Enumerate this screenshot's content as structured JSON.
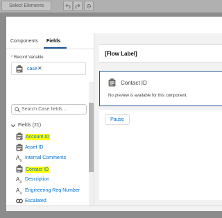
{
  "toolbar": {
    "select_elements_label": "Select Elements",
    "undo_icon": "undo-icon",
    "redo_icon": "redo-icon",
    "settings_icon": "gear-icon"
  },
  "palette": {
    "tabs": [
      {
        "label": "Components",
        "active": false
      },
      {
        "label": "Fields",
        "active": true
      }
    ],
    "record_variable": {
      "required_marker": "*",
      "label": "Record Variable",
      "value": "case",
      "remove_symbol": "✕"
    },
    "search": {
      "placeholder": "Search Case fields..."
    },
    "fields_header": "Fields (21)",
    "fields": [
      {
        "label": "Account ID",
        "icon": "id-card-icon",
        "highlighted": true
      },
      {
        "label": "Asset ID",
        "icon": "id-card-icon",
        "highlighted": false
      },
      {
        "label": "Internal Comments",
        "icon": "text-area-icon",
        "highlighted": false
      },
      {
        "label": "Contact ID",
        "icon": "id-card-icon",
        "highlighted": true
      },
      {
        "label": "Description",
        "icon": "text-area-icon",
        "highlighted": false
      },
      {
        "label": "Engineering Req Number",
        "icon": "text-area-icon",
        "highlighted": false
      },
      {
        "label": "Escalated",
        "icon": "toggle-icon",
        "highlighted": false
      }
    ]
  },
  "canvas": {
    "flow_label": "[Flow Label]",
    "component": {
      "title": "Contact ID",
      "note": "No preview is available for this component."
    },
    "pause_label": "Pause"
  },
  "colors": {
    "link": "#0070d2",
    "accent": "#1b5297",
    "highlight": "#ffff00"
  }
}
